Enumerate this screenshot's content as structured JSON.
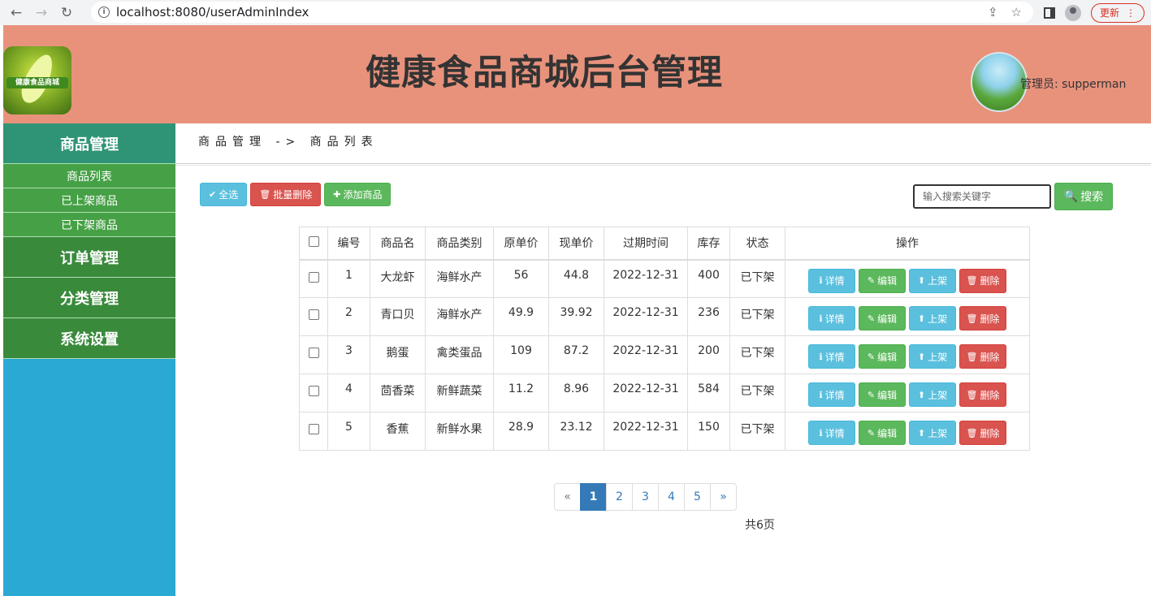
{
  "browser": {
    "url": "localhost:8080/userAdminIndex",
    "update_label": "更新"
  },
  "header": {
    "logo_text": "健康食品商城",
    "title": "健康食品商城后台管理",
    "admin": "管理员: supperman"
  },
  "sidebar": {
    "groups": [
      {
        "label": "商品管理"
      },
      {
        "label": "订单管理"
      },
      {
        "label": "分类管理"
      },
      {
        "label": "系统设置"
      }
    ],
    "sub_items": [
      "商品列表",
      "已上架商品",
      "已下架商品"
    ]
  },
  "breadcrumb": "商品管理 -> 商品列表",
  "toolbar": {
    "select_all": "全选",
    "batch_delete": "批量删除",
    "add_product": "添加商品"
  },
  "search": {
    "placeholder": "输入搜索关键字",
    "button": "搜索"
  },
  "table": {
    "headers": [
      "编号",
      "商品名",
      "商品类别",
      "原单价",
      "现单价",
      "过期时间",
      "库存",
      "状态",
      "操作"
    ],
    "rows": [
      {
        "id": "1",
        "name": "大龙虾",
        "category": "海鲜水产",
        "orig_price": "56",
        "price": "44.8",
        "expire": "2022-12-31",
        "stock": "400",
        "status": "已下架"
      },
      {
        "id": "2",
        "name": "青口贝",
        "category": "海鲜水产",
        "orig_price": "49.9",
        "price": "39.92",
        "expire": "2022-12-31",
        "stock": "236",
        "status": "已下架"
      },
      {
        "id": "3",
        "name": "鹅蛋",
        "category": "禽类蛋品",
        "orig_price": "109",
        "price": "87.2",
        "expire": "2022-12-31",
        "stock": "200",
        "status": "已下架"
      },
      {
        "id": "4",
        "name": "茴香菜",
        "category": "新鲜蔬菜",
        "orig_price": "11.2",
        "price": "8.96",
        "expire": "2022-12-31",
        "stock": "584",
        "status": "已下架"
      },
      {
        "id": "5",
        "name": "香蕉",
        "category": "新鲜水果",
        "orig_price": "28.9",
        "price": "23.12",
        "expire": "2022-12-31",
        "stock": "150",
        "status": "已下架"
      }
    ],
    "actions": {
      "detail": "详情",
      "edit": "编辑",
      "shelve": "上架",
      "delete": "删除"
    }
  },
  "pagination": {
    "prev": "«",
    "pages": [
      "1",
      "2",
      "3",
      "4",
      "5"
    ],
    "current": "1",
    "next": "»",
    "total": "共6页"
  },
  "colors": {
    "header_bg": "#e8927c",
    "sidebar_bg": "#2aa9d4",
    "menu_green": "#3a8a3c",
    "menu_active": "#2f9475",
    "btn_info": "#5bc0de",
    "btn_success": "#5cb85c",
    "btn_danger": "#d9534f",
    "pager_active": "#337ab7"
  }
}
